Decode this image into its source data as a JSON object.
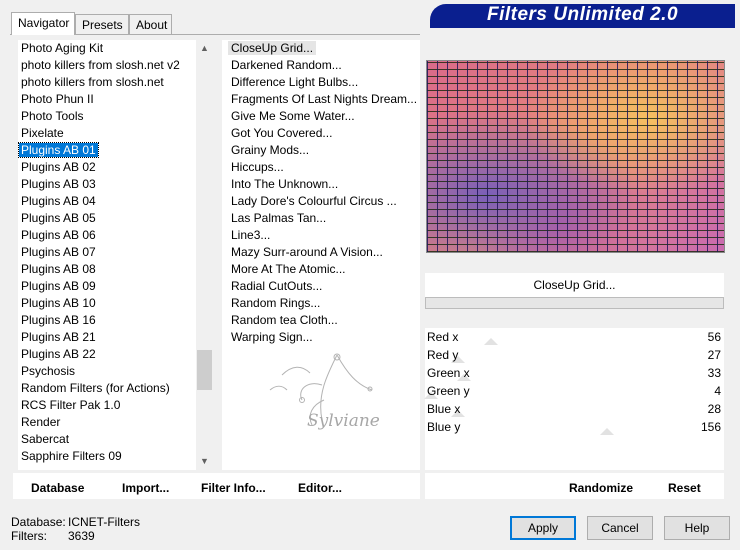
{
  "app": {
    "banner_title": "Filters Unlimited 2.0"
  },
  "tabs": [
    {
      "label": "Navigator",
      "active": true
    },
    {
      "label": "Presets",
      "active": false
    },
    {
      "label": "About",
      "active": false
    }
  ],
  "categories": {
    "selected": "Plugins AB 01",
    "items": [
      "Photo Aging Kit",
      "photo killers from slosh.net v2",
      "photo killers from slosh.net",
      "Photo Phun II",
      "Photo Tools",
      "Pixelate",
      "Plugins AB 01",
      "Plugins AB 02",
      "Plugins AB 03",
      "Plugins AB 04",
      "Plugins AB 05",
      "Plugins AB 06",
      "Plugins AB 07",
      "Plugins AB 08",
      "Plugins AB 09",
      "Plugins AB 10",
      "Plugins AB 16",
      "Plugins AB 21",
      "Plugins AB 22",
      "Psychosis",
      "Random Filters (for Actions)",
      "RCS Filter Pak 1.0",
      "Render",
      "Sabercat",
      "Sapphire Filters 09"
    ],
    "scroll_up_icon": "chevron-up",
    "scroll_down_icon": "chevron-down"
  },
  "filters": {
    "selected": "CloseUp Grid...",
    "items": [
      "CloseUp Grid...",
      "Darkened Random...",
      "Difference Light Bulbs...",
      "Fragments Of Last Nights Dream...",
      "Give Me Some Water...",
      "Got You Covered...",
      "Grainy Mods...",
      "Hiccups...",
      "Into The Unknown...",
      "Lady Dore's Colourful Circus ...",
      "Las Palmas Tan...",
      "Line3...",
      "Mazy Surr-around A Vision...",
      "More At The Atomic...",
      "Radial CutOuts...",
      "Random Rings...",
      "Random tea Cloth...",
      "Warping Sign..."
    ]
  },
  "preview": {
    "filter_name": "CloseUp Grid...",
    "progress": 0
  },
  "params": [
    {
      "label": "Red x",
      "value": "56",
      "level": 0.22
    },
    {
      "label": "Red y",
      "value": "27",
      "level": 0.11
    },
    {
      "label": "Green x",
      "value": "33",
      "level": 0.13
    },
    {
      "label": "Green y",
      "value": "4",
      "level": 0.02
    },
    {
      "label": "Blue x",
      "value": "28",
      "level": 0.11
    },
    {
      "label": "Blue y",
      "value": "156",
      "level": 0.61
    }
  ],
  "buttons": {
    "database": "Database",
    "import": "Import...",
    "filter_info": "Filter Info...",
    "editor": "Editor...",
    "randomize": "Randomize",
    "reset": "Reset",
    "apply": "Apply",
    "cancel": "Cancel",
    "help": "Help"
  },
  "status": {
    "database_label": "Database:",
    "database_value": "ICNET-Filters",
    "filters_label": "Filters:",
    "filters_value": "3639"
  },
  "watermark": {
    "text": "Sylviane"
  },
  "colors": {
    "banner": "#0a1f8f",
    "selection": "#0078d7",
    "default_button_border": "#0078d7"
  }
}
